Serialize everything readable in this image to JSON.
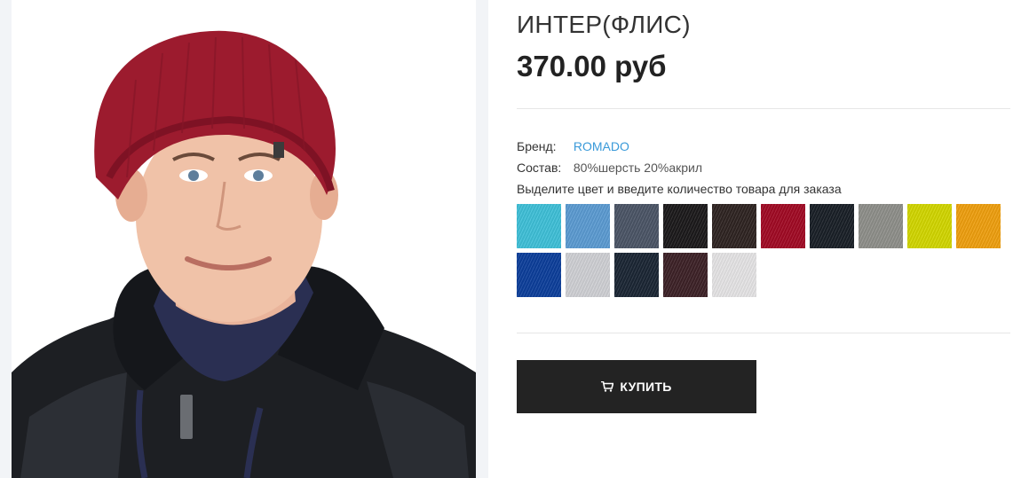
{
  "product": {
    "title": "ИНТЕР(ФЛИС)",
    "price": "370.00 руб",
    "image_alt": "man wearing red knit beanie"
  },
  "specs": {
    "brand_label": "Бренд:",
    "brand_value": "ROMADO",
    "composition_label": "Состав:",
    "composition_value": "80%шерсть 20%акрил"
  },
  "color_hint": "Выделите цвет и введите количество товара для заказа",
  "swatches": [
    {
      "name": "turquoise",
      "color": "#3fc0d8"
    },
    {
      "name": "sky-blue",
      "color": "#5b9bd2"
    },
    {
      "name": "slate-gray",
      "color": "#4b5566"
    },
    {
      "name": "black",
      "color": "#1c1a1b"
    },
    {
      "name": "dark-brown",
      "color": "#2f2422"
    },
    {
      "name": "burgundy",
      "color": "#a10a24"
    },
    {
      "name": "navy-black",
      "color": "#1a2027"
    },
    {
      "name": "gray",
      "color": "#8e8f8a"
    },
    {
      "name": "lime-yellow",
      "color": "#d2d600"
    },
    {
      "name": "orange",
      "color": "#ef9f0f"
    },
    {
      "name": "royal-blue",
      "color": "#0d3f9b"
    },
    {
      "name": "light-gray",
      "color": "#cfd0d4"
    },
    {
      "name": "dark-navy",
      "color": "#1b2634"
    },
    {
      "name": "plum",
      "color": "#3d2227"
    },
    {
      "name": "off-white",
      "color": "#e6e4e6"
    }
  ],
  "buy_button": {
    "label": "КУПИТЬ",
    "icon": "cart-icon"
  },
  "colors": {
    "accent_link": "#3a9ad9",
    "button_bg": "#232323"
  }
}
